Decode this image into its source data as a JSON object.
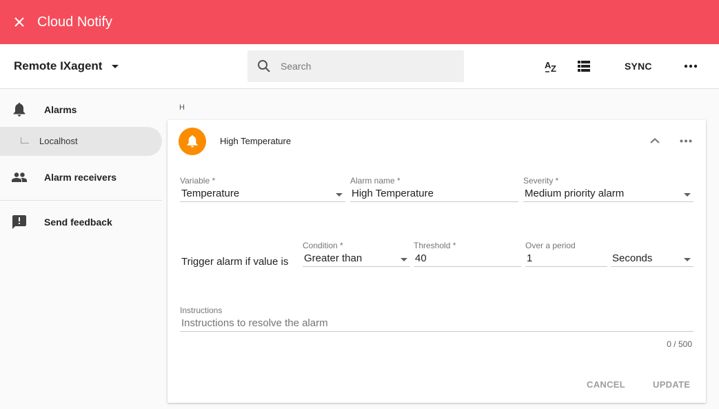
{
  "app": {
    "title": "Cloud Notify"
  },
  "toolbar": {
    "agent": "Remote IXagent",
    "search_placeholder": "Search",
    "sort_icon": "sort-az-icon",
    "list_icon": "list-view-icon",
    "sync_label": "SYNC",
    "more_icon": "more-horiz-icon"
  },
  "sidebar": {
    "alarms": "Alarms",
    "localhost": "Localhost",
    "receivers": "Alarm receivers",
    "feedback": "Send feedback"
  },
  "group_letter": "H",
  "alarm": {
    "title": "High Temperature",
    "variable": {
      "label": "Variable *",
      "value": "Temperature"
    },
    "name": {
      "label": "Alarm name *",
      "value": "High Temperature"
    },
    "severity": {
      "label": "Severity *",
      "value": "Medium priority alarm"
    },
    "trigger_text": "Trigger alarm if value is",
    "condition": {
      "label": "Condition *",
      "value": "Greater than"
    },
    "threshold": {
      "label": "Threshold *",
      "value": "40"
    },
    "period": {
      "label": "Over a period",
      "value": "1"
    },
    "period_unit": {
      "value": "Seconds"
    },
    "instructions": {
      "label": "Instructions",
      "placeholder": "Instructions to resolve the alarm"
    },
    "counter": "0 / 500",
    "cancel": "CANCEL",
    "update": "UPDATE"
  },
  "colors": {
    "header": "#f54c5b",
    "avatar": "#fb8c00"
  }
}
